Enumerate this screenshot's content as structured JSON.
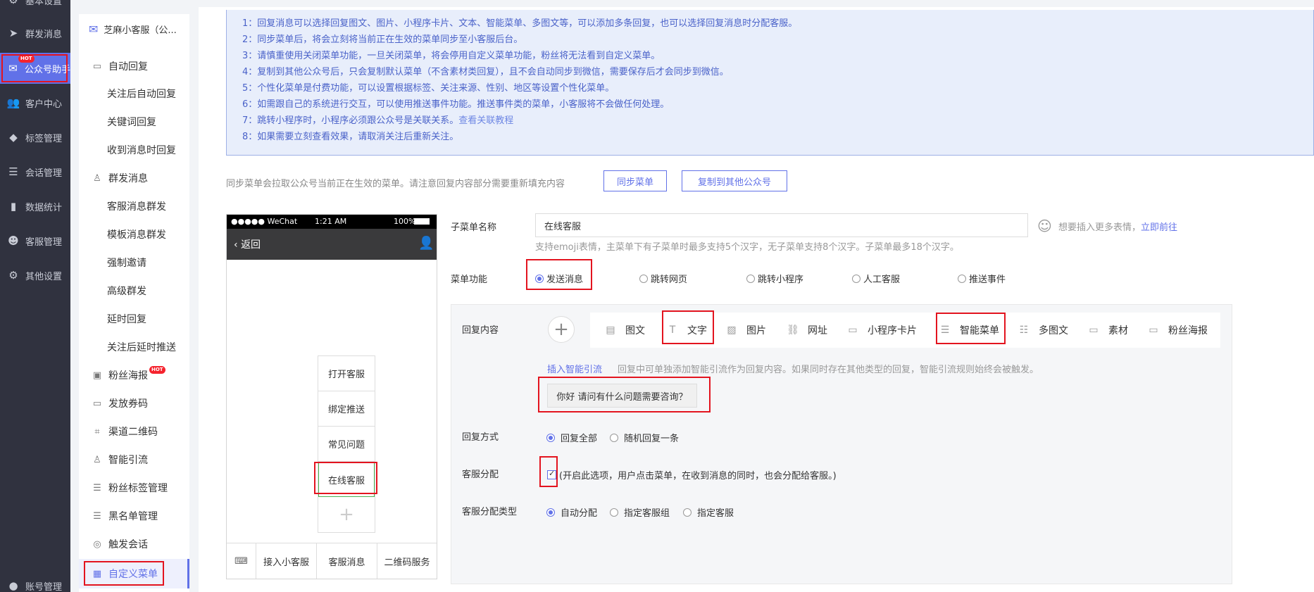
{
  "nav": {
    "items": [
      {
        "label": "基本设置",
        "icon": "gear-icon"
      },
      {
        "label": "群发消息",
        "icon": "send-icon"
      },
      {
        "label": "公众号助手",
        "icon": "wechat-icon",
        "hot": "HOT"
      },
      {
        "label": "客户中心",
        "icon": "users-icon"
      },
      {
        "label": "标签管理",
        "icon": "tag-icon"
      },
      {
        "label": "会话管理",
        "icon": "chat-icon"
      },
      {
        "label": "数据统计",
        "icon": "chart-icon"
      },
      {
        "label": "客服管理",
        "icon": "robot-icon"
      },
      {
        "label": "其他设置",
        "icon": "settings-icon"
      },
      {
        "label": "账号管理",
        "icon": "account-icon"
      }
    ]
  },
  "sub": {
    "account": "芝麻小客服（公...",
    "items": [
      {
        "label": "自动回复"
      },
      {
        "label": "关注后自动回复"
      },
      {
        "label": "关键词回复"
      },
      {
        "label": "收到消息时回复"
      },
      {
        "label": "群发消息"
      },
      {
        "label": "客服消息群发"
      },
      {
        "label": "模板消息群发"
      },
      {
        "label": "强制邀请"
      },
      {
        "label": "高级群发"
      },
      {
        "label": "延时回复"
      },
      {
        "label": "关注后延时推送"
      },
      {
        "label": "粉丝海报",
        "hot": "HOT"
      },
      {
        "label": "发放券码"
      },
      {
        "label": "渠道二维码"
      },
      {
        "label": "智能引流"
      },
      {
        "label": "粉丝标签管理"
      },
      {
        "label": "黑名单管理"
      },
      {
        "label": "触发会话"
      },
      {
        "label": "自定义菜单"
      }
    ]
  },
  "notice": {
    "lines": [
      "1：回复消息可以选择回复图文、图片、小程序卡片、文本、智能菜单、多图文等，可以添加多条回复，也可以选择回复消息时分配客服。",
      "2：同步菜单后，将会立刻将当前正在生效的菜单同步至小客服后台。",
      "3：请慎重使用关闭菜单功能，一旦关闭菜单，将会停用自定义菜单功能，粉丝将无法看到自定义菜单。",
      "4：复制到其他公众号后，只会复制默认菜单（不含素材类回复），且不会自动同步到微信，需要保存后才会同步到微信。",
      "5：个性化菜单是付费功能，可以设置根据标签、关注来源、性别、地区等设置个性化菜单。",
      "6：如需跟自己的系统进行交互，可以使用推送事件功能。推送事件类的菜单，小客服将不会做任何处理。",
      "7：跳转小程序时，小程序必须跟公众号是关联关系。",
      "8：如果需要立刻查看效果，请取消关注后重新关注。"
    ],
    "link": "查看关联教程"
  },
  "sync": {
    "hint": "同步菜单会拉取公众号当前正在生效的菜单。请注意回复内容部分需要重新填充内容",
    "sync_btn": "同步菜单",
    "copy_btn": "复制到其他公众号"
  },
  "phone": {
    "carrier": "●●●●● WeChat",
    "time": "1:21 AM",
    "battery": "100%",
    "back": "返回",
    "submenu": [
      "打开客服",
      "绑定推送",
      "常见问题",
      "在线客服"
    ],
    "bottom": [
      "接入小客服",
      "客服消息",
      "二维码服务"
    ]
  },
  "form": {
    "name_label": "子菜单名称",
    "name_value": "在线客服",
    "emoji_hint": "想要插入更多表情，",
    "emoji_link": "立即前往",
    "name_tip": "支持emoji表情，主菜单下有子菜单时最多支持5个汉字，无子菜单支持8个汉字。子菜单最多18个汉字。",
    "func_label": "菜单功能",
    "func_options": [
      "发送消息",
      "跳转网页",
      "跳转小程序",
      "人工客服",
      "推送事件"
    ],
    "func_selected": 0,
    "reply_label": "回复内容",
    "tools": [
      {
        "label": "图文",
        "icon": "article-icon"
      },
      {
        "label": "文字",
        "icon": "text-icon"
      },
      {
        "label": "图片",
        "icon": "image-icon"
      },
      {
        "label": "网址",
        "icon": "link-icon"
      },
      {
        "label": "小程序卡片",
        "icon": "miniprogram-card-icon"
      },
      {
        "label": "智能菜单",
        "icon": "smart-menu-icon"
      },
      {
        "label": "多图文",
        "icon": "multi-article-icon"
      },
      {
        "label": "素材",
        "icon": "material-icon"
      },
      {
        "label": "粉丝海报",
        "icon": "poster-icon"
      }
    ],
    "smart_link": "插入智能引流",
    "smart_tip": "回复中可单独添加智能引流作为回复内容。如果同时存在其他类型的回复，智能引流规则始终会被触发。",
    "reply_text": "你好 请问有什么问题需要咨询？",
    "mode_label": "回复方式",
    "mode_options": [
      "回复全部",
      "随机回复一条"
    ],
    "assign_label": "客服分配",
    "assign_tip": "(开启此选项，用户点击菜单，在收到消息的同时，也会分配给客服。)",
    "assign_type_label": "客服分配类型",
    "assign_type_options": [
      "自动分配",
      "指定客服组",
      "指定客服"
    ]
  },
  "colors": {
    "accent": "#6171e8",
    "highlight": "#e3141f",
    "nav_bg": "#30323f"
  }
}
